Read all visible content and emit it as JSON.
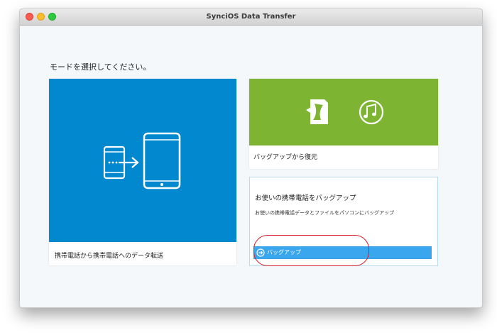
{
  "window": {
    "title": "SynciOS Data Transfer"
  },
  "prompt": "モードを選択してください。",
  "cards": {
    "transfer": {
      "label": "携帯電話から携帯電話へのデータ転送",
      "color": "#0288cf"
    },
    "restore": {
      "label": "バッグアップから復元",
      "color": "#7db532"
    },
    "backup": {
      "title": "お使いの携帯電話をバッグアップ",
      "description": "お使いの携帯電話データとファイルをパソコンにバッグアップ",
      "button_label": "バッグアップ",
      "button_color": "#3aa6ee"
    }
  },
  "icons": {
    "transfer": "phone-to-tablet-icon",
    "restore_backup": "backup-file-icon",
    "music": "music-note-icon",
    "button": "arrow-circle-icon"
  },
  "annotation_color": "#d81e2c"
}
